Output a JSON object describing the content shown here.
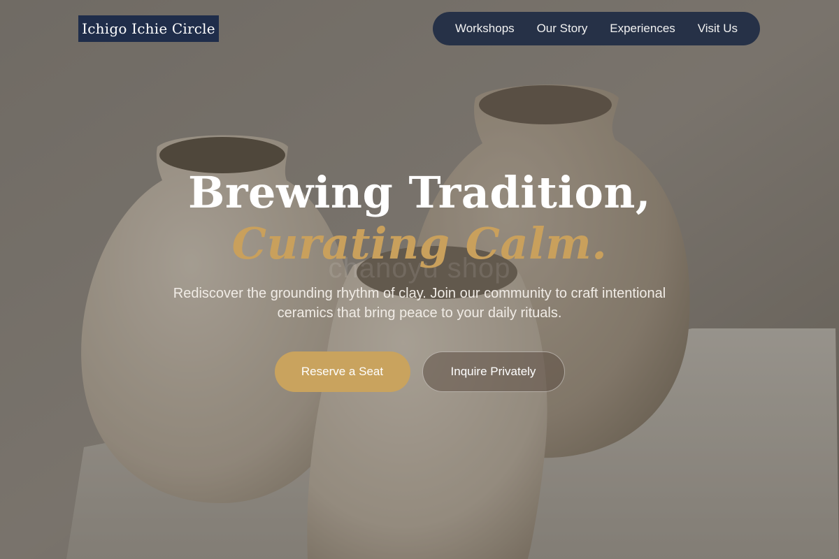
{
  "brand": {
    "name": "Ichigo Ichie Circle"
  },
  "nav": {
    "items": [
      {
        "label": "Workshops"
      },
      {
        "label": "Our Story"
      },
      {
        "label": "Experiences"
      },
      {
        "label": "Visit Us"
      }
    ]
  },
  "hero": {
    "title_line1": "Brewing Tradition,",
    "title_line2": "Curating Calm.",
    "subtitle": "Rediscover the grounding rhythm of clay. Join our community to craft intentional ceramics that bring peace to your daily rituals.",
    "watermark": "chanoyu shop",
    "primary_cta": "Reserve a Seat",
    "secondary_cta": "Inquire Privately"
  },
  "colors": {
    "brand_navy": "#1f2d4a",
    "nav_bg": "#263147",
    "accent_gold": "#c9a35e",
    "title_white": "#ffffff"
  }
}
